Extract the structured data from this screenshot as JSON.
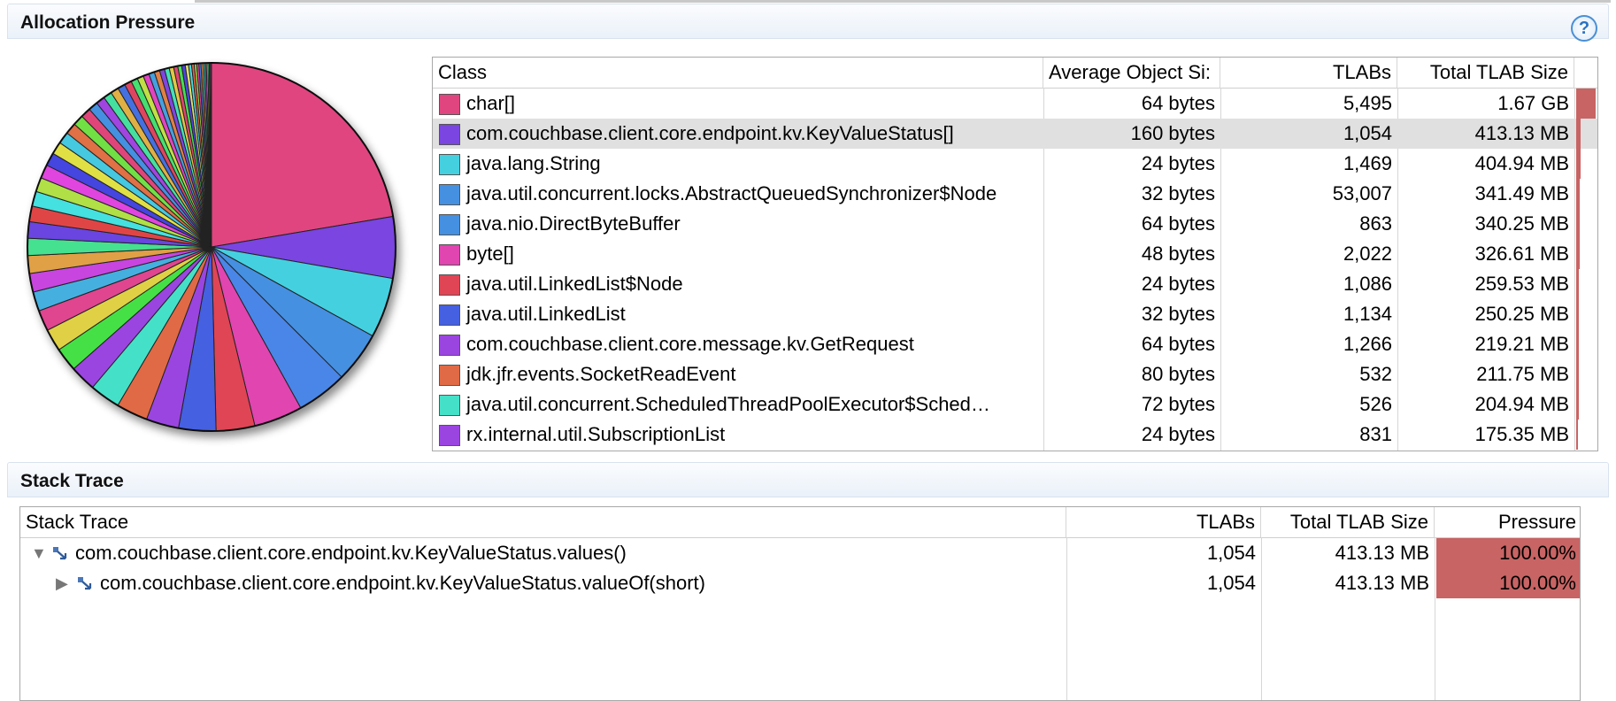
{
  "allocation": {
    "title": "Allocation Pressure",
    "help_icon": "help-icon",
    "help_glyph": "?",
    "columns": [
      "Class",
      "Average Object Si:",
      "TLABs",
      "Total TLAB Size"
    ],
    "rows": [
      {
        "cls": "char[]",
        "avg": "64 bytes",
        "tlabs": "5,495",
        "total": "1.67 GB",
        "color": "#e0457f",
        "pressure": 1.0
      },
      {
        "cls": "com.couchbase.client.core.endpoint.kv.KeyValueStatus[]",
        "avg": "160 bytes",
        "tlabs": "1,054",
        "total": "413.13 MB",
        "color": "#7a45e0",
        "pressure": 0.24,
        "selected": true
      },
      {
        "cls": "java.lang.String",
        "avg": "24 bytes",
        "tlabs": "1,469",
        "total": "404.94 MB",
        "color": "#45d0e0",
        "pressure": 0.24
      },
      {
        "cls": "java.util.concurrent.locks.AbstractQueuedSynchronizer$Node",
        "avg": "32 bytes",
        "tlabs": "53,007",
        "total": "341.49 MB",
        "color": "#4590e0",
        "pressure": 0.2
      },
      {
        "cls": "java.nio.DirectByteBuffer",
        "avg": "64 bytes",
        "tlabs": "863",
        "total": "340.25 MB",
        "color": "#4590e0",
        "pressure": 0.2
      },
      {
        "cls": "byte[]",
        "avg": "48 bytes",
        "tlabs": "2,022",
        "total": "326.61 MB",
        "color": "#e045b0",
        "pressure": 0.19
      },
      {
        "cls": "java.util.LinkedList$Node",
        "avg": "24 bytes",
        "tlabs": "1,086",
        "total": "259.53 MB",
        "color": "#e04555",
        "pressure": 0.15
      },
      {
        "cls": "java.util.LinkedList",
        "avg": "32 bytes",
        "tlabs": "1,134",
        "total": "250.25 MB",
        "color": "#4560e0",
        "pressure": 0.15
      },
      {
        "cls": "com.couchbase.client.core.message.kv.GetRequest",
        "avg": "64 bytes",
        "tlabs": "1,266",
        "total": "219.21 MB",
        "color": "#9b45e0",
        "pressure": 0.13
      },
      {
        "cls": "jdk.jfr.events.SocketReadEvent",
        "avg": "80 bytes",
        "tlabs": "532",
        "total": "211.75 MB",
        "color": "#e06a45",
        "pressure": 0.12
      },
      {
        "cls": "java.util.concurrent.ScheduledThreadPoolExecutor$Sched…",
        "avg": "72 bytes",
        "tlabs": "526",
        "total": "204.94 MB",
        "color": "#45e0c8",
        "pressure": 0.12
      },
      {
        "cls": "rx.internal.util.SubscriptionList",
        "avg": "24 bytes",
        "tlabs": "831",
        "total": "175.35 MB",
        "color": "#9b45e0",
        "pressure": 0.1
      }
    ]
  },
  "stack": {
    "title": "Stack Trace",
    "columns": [
      "Stack Trace",
      "TLABs",
      "Total TLAB Size",
      "Pressure"
    ],
    "rows": [
      {
        "expander": "▼",
        "method": "com.couchbase.client.core.endpoint.kv.KeyValueStatus.values()",
        "tlabs": "1,054",
        "total": "413.13 MB",
        "pressure": "100.00%",
        "pressure_value": 1.0,
        "level": 0
      },
      {
        "expander": "▶",
        "method": "com.couchbase.client.core.endpoint.kv.KeyValueStatus.valueOf(short)",
        "tlabs": "1,054",
        "total": "413.13 MB",
        "pressure": "100.00%",
        "pressure_value": 1.0,
        "level": 1
      }
    ]
  },
  "chart_data": {
    "type": "pie",
    "title": "",
    "values": [
      1710,
      413.13,
      404.94,
      341.49,
      340.25,
      326.61,
      259.53,
      250.25,
      219.21,
      211.75,
      204.94,
      175.35,
      160,
      150,
      140,
      130,
      125,
      120,
      115,
      110,
      105,
      100,
      96,
      92,
      88,
      84,
      80,
      76,
      72,
      68,
      64,
      60,
      57,
      54,
      51,
      48,
      45,
      42,
      40,
      38,
      36,
      34,
      32,
      30,
      28,
      26,
      24,
      22,
      20,
      18,
      16,
      15,
      14,
      13,
      12,
      11,
      10,
      9,
      8,
      7
    ],
    "colors": [
      "#e0457f",
      "#7a45e0",
      "#45d0e0",
      "#4590e0",
      "#4a86e8",
      "#e045b0",
      "#e04555",
      "#4560e0",
      "#9b45e0",
      "#e06a45",
      "#45e0c8",
      "#9b45e0",
      "#45e045",
      "#e0d045",
      "#e04590",
      "#45b0e0",
      "#c845e0",
      "#e0a045",
      "#45e090",
      "#6a45e0",
      "#e04545",
      "#45e0e0",
      "#b0e045",
      "#e045e0",
      "#4545e0",
      "#e0e045",
      "#45c8e0",
      "#e07045",
      "#70e045",
      "#e0457a",
      "#4590e0",
      "#a045e0",
      "#45e0a0",
      "#e0b045",
      "#4570e0",
      "#e04560",
      "#45e070",
      "#c0e045",
      "#e045c0",
      "#45a0e0",
      "#e08045",
      "#8045e0",
      "#45e0b8",
      "#e0c845",
      "#e04570",
      "#45e050",
      "#5045e0",
      "#e0e070",
      "#45d8e0",
      "#e06045",
      "#a0e045",
      "#e045a0",
      "#4580e0",
      "#e09045",
      "#45e0d0",
      "#d045e0",
      "#e0e045",
      "#45e080",
      "#e04580",
      "#4560e0"
    ]
  }
}
